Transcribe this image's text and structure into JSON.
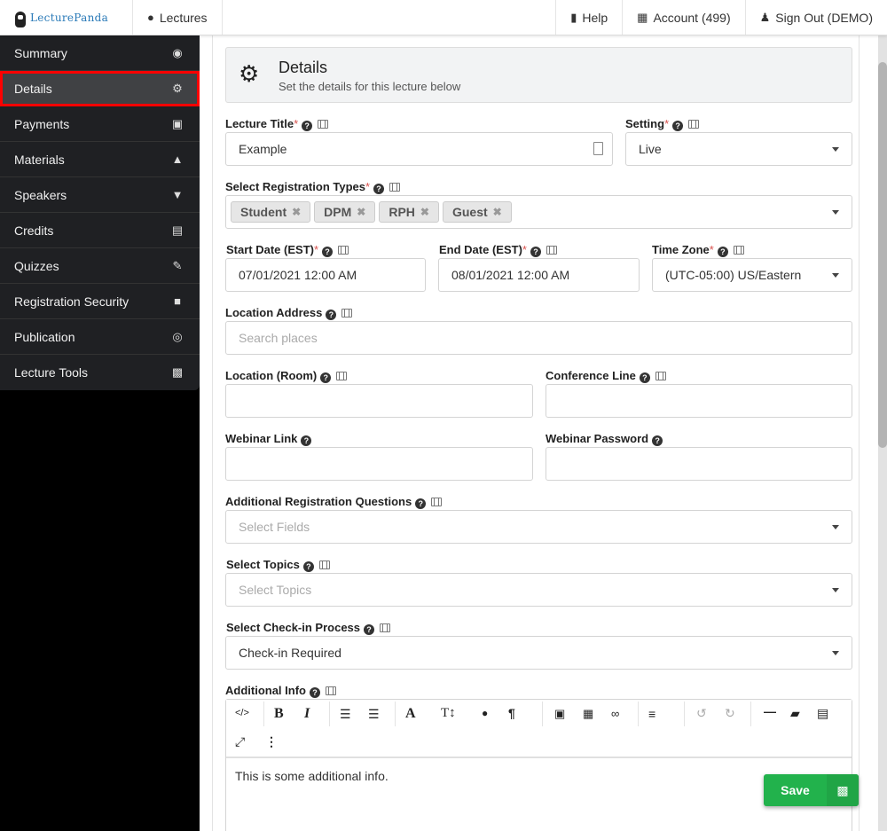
{
  "topbar": {
    "brand": "LecturePanda",
    "lectures": "Lectures",
    "help": "Help",
    "account": "Account (499)",
    "signout": "Sign Out (DEMO)"
  },
  "sidebar": {
    "items": [
      {
        "label": "Summary",
        "icon": "eye-icon"
      },
      {
        "label": "Details",
        "icon": "gears-icon",
        "active": true
      },
      {
        "label": "Payments",
        "icon": "money-icon"
      },
      {
        "label": "Materials",
        "icon": "graduation-cap-icon"
      },
      {
        "label": "Speakers",
        "icon": "microphone-icon"
      },
      {
        "label": "Credits",
        "icon": "bank-icon"
      },
      {
        "label": "Quizzes",
        "icon": "pencil-icon"
      },
      {
        "label": "Registration Security",
        "icon": "lock-icon"
      },
      {
        "label": "Publication",
        "icon": "globe-icon"
      },
      {
        "label": "Lecture Tools",
        "icon": "briefcase-icon"
      }
    ]
  },
  "header": {
    "title": "Details",
    "subtitle": "Set the details for this lecture below"
  },
  "form": {
    "lecture_title": {
      "label": "Lecture Title",
      "value": "Example"
    },
    "setting": {
      "label": "Setting",
      "value": "Live"
    },
    "registration_types": {
      "label": "Select Registration Types",
      "tags": [
        "Student",
        "DPM",
        "RPH",
        "Guest"
      ]
    },
    "start_date": {
      "label": "Start Date (EST)",
      "value": "07/01/2021 12:00 AM"
    },
    "end_date": {
      "label": "End Date (EST)",
      "value": "08/01/2021 12:00 AM"
    },
    "time_zone": {
      "label": "Time Zone",
      "value": "(UTC-05:00) US/Eastern"
    },
    "location_address": {
      "label": "Location Address",
      "placeholder": "Search places"
    },
    "location_room": {
      "label": "Location (Room)",
      "value": ""
    },
    "conference_line": {
      "label": "Conference Line",
      "value": ""
    },
    "webinar_link": {
      "label": "Webinar Link",
      "value": ""
    },
    "webinar_password": {
      "label": "Webinar Password",
      "value": ""
    },
    "additional_questions": {
      "label": "Additional Registration Questions",
      "placeholder": "Select Fields"
    },
    "topics": {
      "label": "Select Topics",
      "placeholder": "Select Topics"
    },
    "checkin": {
      "label": "Select Check-in Process",
      "value": "Check-in Required"
    },
    "additional_info": {
      "label": "Additional Info",
      "value": "This is some additional info."
    }
  },
  "save_label": "Save"
}
